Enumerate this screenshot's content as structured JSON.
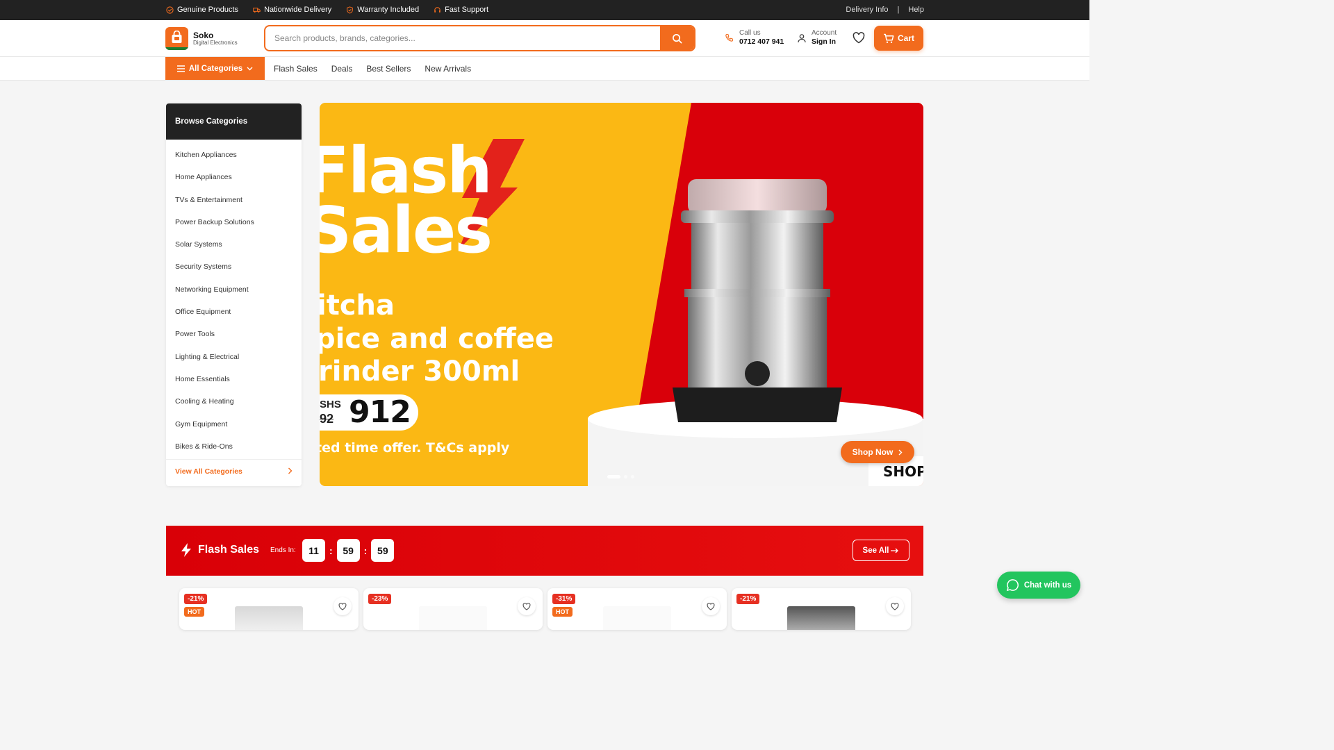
{
  "topbar": {
    "perks": [
      "Genuine Products",
      "Nationwide Delivery",
      "Warranty Included",
      "Fast Support"
    ],
    "links": [
      "Delivery Info",
      "|",
      "Help"
    ]
  },
  "header": {
    "brand": "Soko",
    "brand_sub": "Digital Electronics",
    "search_placeholder": "Search products, brands, categories...",
    "call_label": "Call us",
    "call_number": "0712 407 941",
    "account_label": "Account",
    "account_action": "Sign In",
    "cart_label": "Cart"
  },
  "nav": {
    "all_categories": "All Categories",
    "links": [
      "Flash Sales",
      "Deals",
      "Best Sellers",
      "New Arrivals"
    ]
  },
  "sidebar": {
    "title": "Browse Categories",
    "items": [
      "Kitchen Appliances",
      "Home Appliances",
      "TVs & Entertainment",
      "Power Backup Solutions",
      "Solar Systems",
      "Security Systems",
      "Networking Equipment",
      "Office Equipment",
      "Power Tools",
      "Lighting & Electrical",
      "Home Essentials",
      "Cooling & Heating",
      "Gym Equipment",
      "Bikes & Ride-Ons"
    ],
    "view_all": "View All Categories"
  },
  "hero": {
    "line1": "Flash",
    "line2": "Sales",
    "product1": "itcha",
    "product2": "pice and coffee",
    "product3": "rinder 300ml",
    "currency": "SHS",
    "old_price": "92",
    "price": "912",
    "terms": "ted time offer. T&Cs apply",
    "cta": "Shop Now",
    "tag": "SHOP",
    "colors": {
      "yellow": "#fbb814",
      "red": "#d9000a",
      "accent": "#f26b1d"
    }
  },
  "flash": {
    "title": "Flash Sales",
    "ends_in": "Ends In:",
    "hours": "11",
    "minutes": "59",
    "seconds": "59",
    "see_all": "See All"
  },
  "cards": [
    {
      "discount": "-21%",
      "hot": "HOT"
    },
    {
      "discount": "-23%",
      "hot": ""
    },
    {
      "discount": "-31%",
      "hot": "HOT"
    },
    {
      "discount": "-21%",
      "hot": ""
    }
  ],
  "chat": {
    "label": "Chat with us"
  }
}
